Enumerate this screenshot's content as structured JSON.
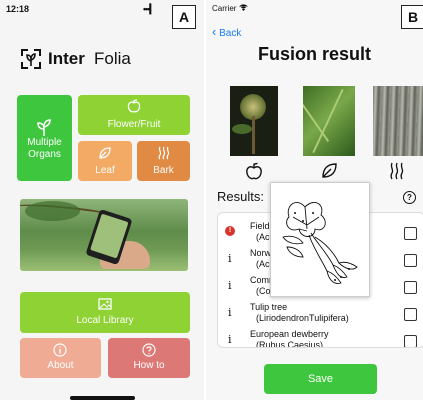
{
  "panel_a": {
    "tag": "A",
    "status_time": "12:18",
    "signal": "•••▎",
    "logo_text": "Inter",
    "logo_text2": "Folia",
    "multiple_organs": "Multiple\nOrgans",
    "flower_fruit": "Flower/Fruit",
    "leaf": "Leaf",
    "bark": "Bark",
    "local_library": "Local Library",
    "about": "About",
    "how_to": "How to",
    "colors": {
      "green": "#8ed234",
      "green_dark": "#3ec63e",
      "orange_light": "#f2aa64",
      "orange_dark": "#e08a44",
      "salmon": "#f0ab95",
      "rose": "#dc7876"
    }
  },
  "panel_b": {
    "tag": "B",
    "carrier": "Carrier",
    "back": "Back",
    "title": "Fusion result",
    "results_label": "Results:",
    "help": "?",
    "results": [
      {
        "marker": "!",
        "name": "Field (",
        "latin": "(Acer"
      },
      {
        "marker": "i",
        "name": "Norwa",
        "latin": "(Acer"
      },
      {
        "marker": "i",
        "name": "Comm",
        "latin": "(CornusSanguinea)"
      },
      {
        "marker": "i",
        "name": "Tulip tree",
        "latin": "(LiriodendronTulipifera)"
      },
      {
        "marker": "i",
        "name": "European dewberry",
        "latin": "(Rubus Caesius)"
      }
    ],
    "save": "Save"
  }
}
